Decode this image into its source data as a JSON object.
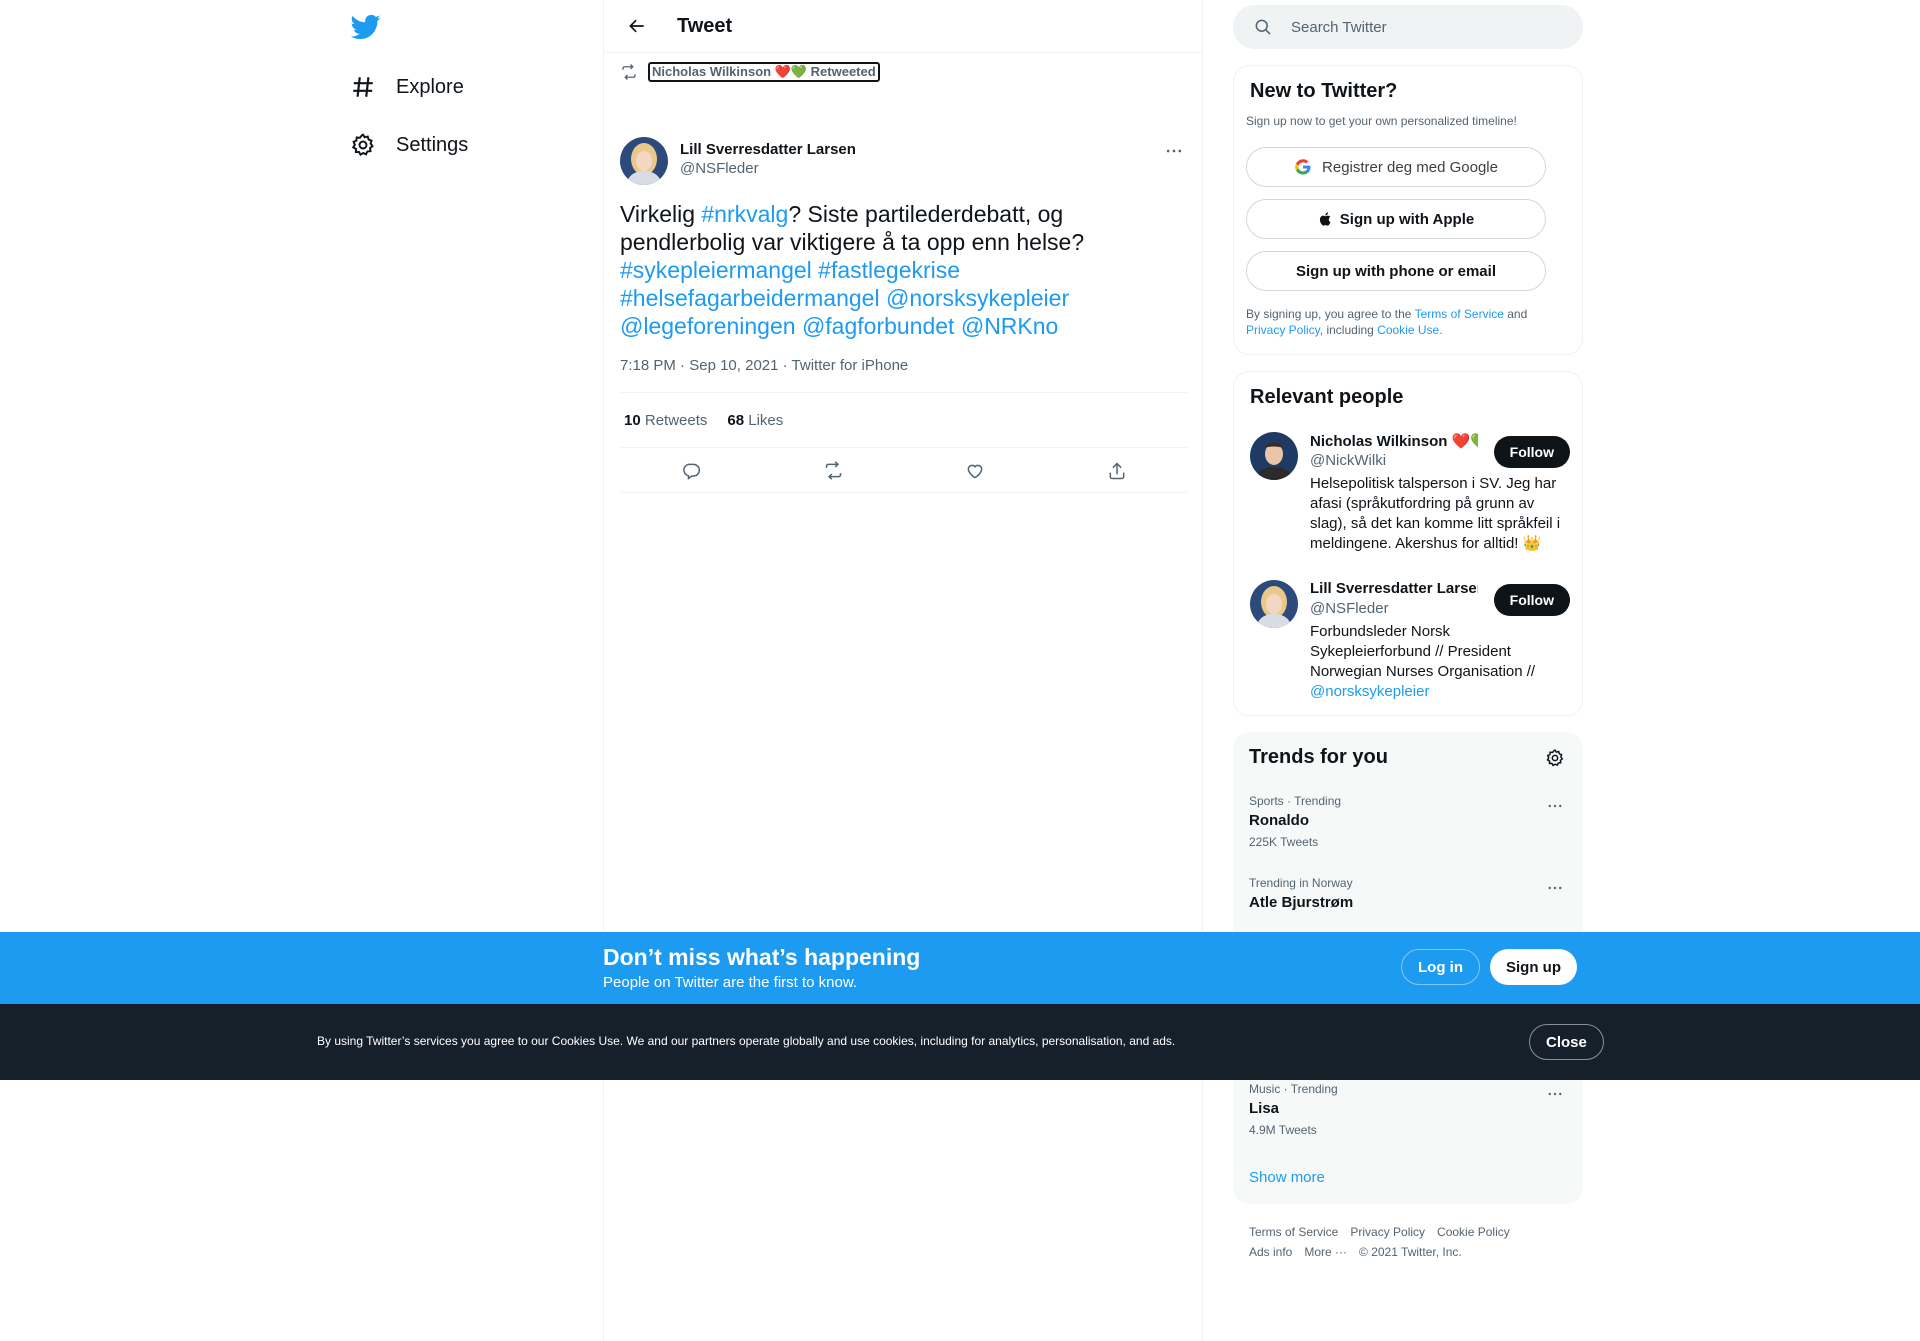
{
  "nav": {
    "items": [
      {
        "label": "Explore",
        "icon": "hashtag-icon"
      },
      {
        "label": "Settings",
        "icon": "gear-icon"
      }
    ]
  },
  "header": {
    "title": "Tweet"
  },
  "tweet": {
    "retweet_context": "Nicholas Wilkinson ❤️💚 Retweeted",
    "author_name": "Lill Sverresdatter Larsen",
    "author_handle": "@NSFleder",
    "text_parts": {
      "p1": "Virkelig ",
      "l1": "#nrkvalg",
      "p2": "? Siste partilederdebatt, og pendlerbolig var viktigere å ta opp enn helse? ",
      "l2": "#sykepleiermangel",
      "l3": "#fastlegekrise",
      "l4": "#helsefagarbeidermangel",
      "l5": "@norsksykepleier",
      "l6": "@legeforeningen",
      "l7": "@fagforbundet",
      "l8": "@NRKno"
    },
    "time": "7:18 PM",
    "date": "Sep 10, 2021",
    "source": "Twitter for iPhone",
    "retweets_count": "10",
    "retweets_label": "Retweets",
    "likes_count": "68",
    "likes_label": "Likes"
  },
  "search": {
    "placeholder": "Search Twitter"
  },
  "new_to_twitter": {
    "title": "New to Twitter?",
    "subtitle": "Sign up now to get your own personalized timeline!",
    "google_label": "Registrer deg med Google",
    "apple_label": "Sign up with Apple",
    "phone_label": "Sign up with phone or email",
    "legal_1": "By signing up, you agree to the ",
    "legal_tos": "Terms of Service",
    "legal_2": " and ",
    "legal_privacy": "Privacy Policy",
    "legal_3": ", including ",
    "legal_cookie": "Cookie Use."
  },
  "relevant_people": {
    "title": "Relevant people",
    "people": [
      {
        "name": "Nicholas Wilkinson ❤️💚",
        "handle": "@NickWilki",
        "bio": "Helsepolitisk talsperson i SV. Jeg har afasi (språkutfordring på grunn av slag), så det kan komme litt språkfeil i meldingene. Akershus for alltid! 👑",
        "follow_label": "Follow"
      },
      {
        "name": "Lill Sverresdatter Larsen",
        "handle": "@NSFleder",
        "bio": "Forbundsleder Norsk Sykepleierforbund // President Norwegian Nurses Organisation // ",
        "bio_link": "@norsksykepleier",
        "follow_label": "Follow"
      }
    ]
  },
  "trends": {
    "title": "Trends for you",
    "items": [
      {
        "context": "Sports · Trending",
        "name": "Ronaldo",
        "count": "225K Tweets"
      },
      {
        "context": "Trending in Norway",
        "name": "Atle Bjurstrøm",
        "count": ""
      },
      {
        "context": "Music · Trending",
        "name": "Lisa",
        "count": "4.9M Tweets"
      }
    ],
    "show_more": "Show more"
  },
  "footer": {
    "links": [
      "Terms of Service",
      "Privacy Policy",
      "Cookie Policy",
      "Ads info",
      "More ···"
    ],
    "copyright": "© 2021 Twitter, Inc."
  },
  "bottom_bar": {
    "title": "Don’t miss what’s happening",
    "subtitle": "People on Twitter are the first to know.",
    "login_label": "Log in",
    "signup_label": "Sign up"
  },
  "cookie_bar": {
    "text": "By using Twitter’s services you agree to our Cookies Use. We and our partners operate globally and use cookies, including for analytics, personalisation, and ads.",
    "close_label": "Close"
  },
  "colors": {
    "accent": "#1d9bf0",
    "text_primary": "#0f1419",
    "text_secondary": "#536471",
    "cookie_bg": "#15202b"
  }
}
